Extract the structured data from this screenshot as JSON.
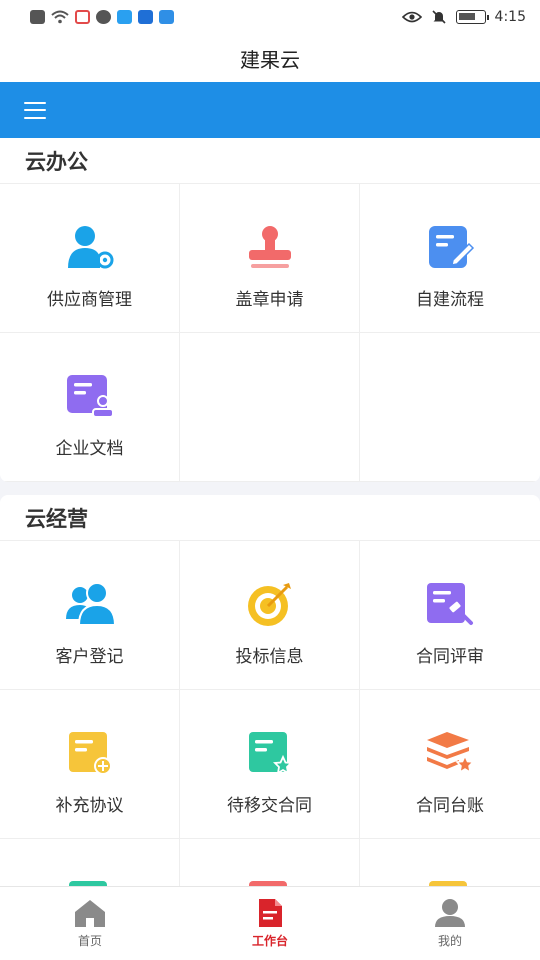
{
  "status_bar": {
    "time": "4:15"
  },
  "app": {
    "title": "建果云"
  },
  "sections": [
    {
      "title": "云办公",
      "items": [
        {
          "label": "供应商管理",
          "icon": "supplier-management-icon",
          "color": "#1aa3e8"
        },
        {
          "label": "盖章申请",
          "icon": "stamp-icon",
          "color": "#f26a6a"
        },
        {
          "label": "自建流程",
          "icon": "edit-document-icon",
          "color": "#4c8ff0"
        },
        {
          "label": "企业文档",
          "icon": "enterprise-document-icon",
          "color": "#8f6cf0"
        }
      ]
    },
    {
      "title": "云经营",
      "items": [
        {
          "label": "客户登记",
          "icon": "customers-icon",
          "color": "#1aa3e8"
        },
        {
          "label": "投标信息",
          "icon": "target-icon",
          "color": "#f5c023"
        },
        {
          "label": "合同评审",
          "icon": "contract-review-icon",
          "color": "#8f6cf0"
        },
        {
          "label": "补充协议",
          "icon": "supplement-agreement-icon",
          "color": "#f6c53a"
        },
        {
          "label": "待移交合同",
          "icon": "pending-contract-icon",
          "color": "#2ec8a0"
        },
        {
          "label": "合同台账",
          "icon": "contract-ledger-icon",
          "color": "#f27a46"
        }
      ]
    }
  ],
  "tabs": [
    {
      "label": "首页",
      "icon": "home-icon",
      "active": false
    },
    {
      "label": "工作台",
      "icon": "workbench-icon",
      "active": true
    },
    {
      "label": "我的",
      "icon": "profile-icon",
      "active": false
    }
  ],
  "colors": {
    "accent_blue": "#1e8ee6",
    "active_tab": "#d9242b",
    "inactive_tab": "#8a8a8a"
  }
}
